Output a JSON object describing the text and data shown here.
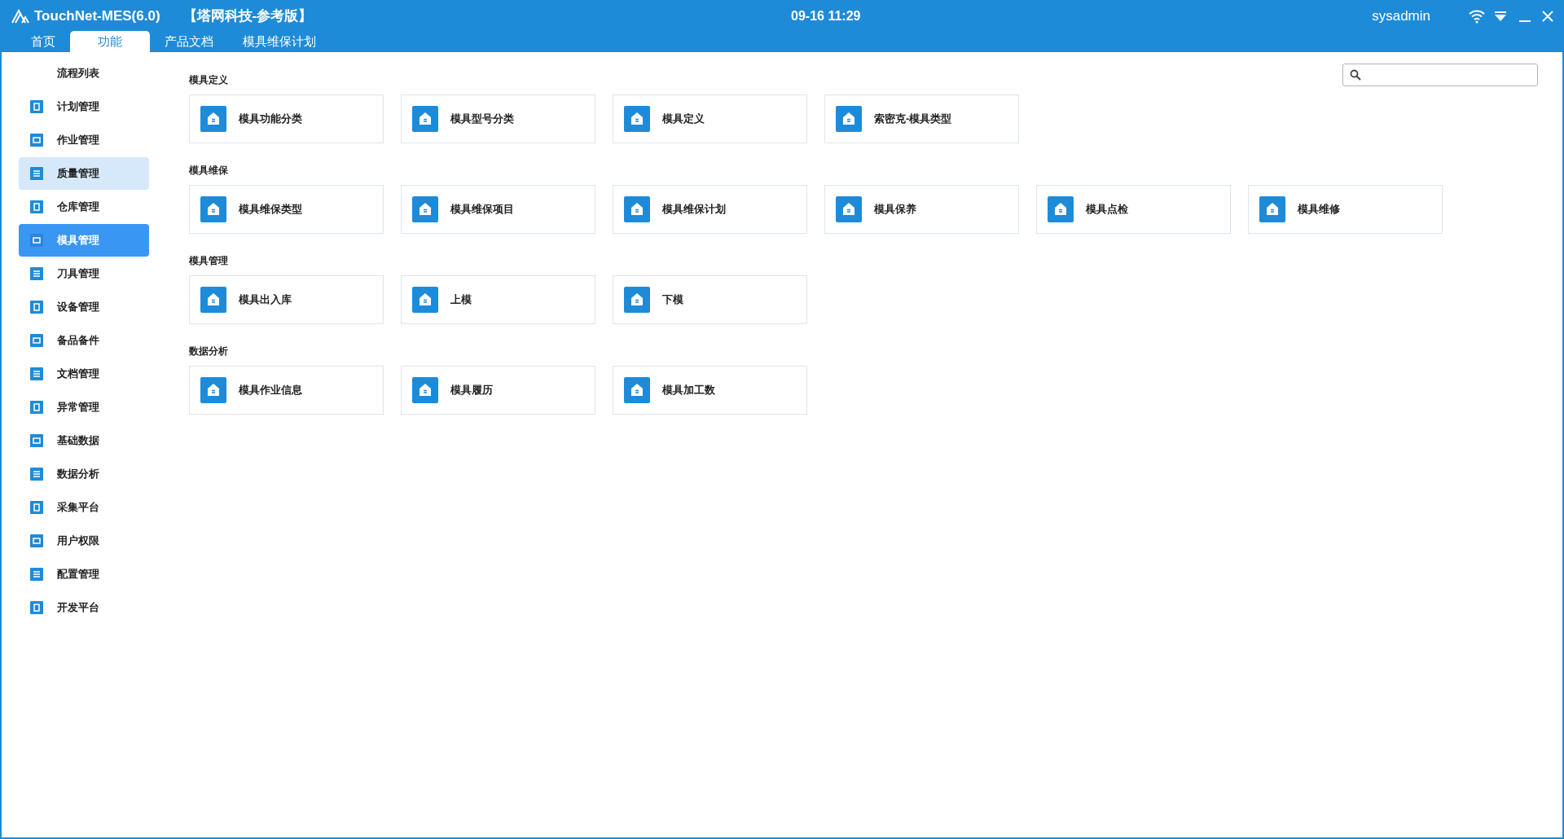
{
  "window": {
    "title": "TouchNet-MES(6.0)",
    "edition": "【塔网科技-参考版】",
    "datetime": "09-16 11:29",
    "user": "sysadmin"
  },
  "tabs": [
    {
      "label": "首页",
      "selected": false
    },
    {
      "label": "功能",
      "selected": true
    },
    {
      "label": "产品文档",
      "selected": false
    },
    {
      "label": "模具维保计划",
      "selected": false
    }
  ],
  "sidebar": {
    "items": [
      {
        "label": "流程列表",
        "kind": "plain",
        "selected": false,
        "hovered": false
      },
      {
        "label": "计划管理",
        "kind": "icon",
        "selected": false,
        "hovered": false
      },
      {
        "label": "作业管理",
        "kind": "icon",
        "selected": false,
        "hovered": false
      },
      {
        "label": "质量管理",
        "kind": "icon",
        "selected": false,
        "hovered": true
      },
      {
        "label": "仓库管理",
        "kind": "icon",
        "selected": false,
        "hovered": false
      },
      {
        "label": "模具管理",
        "kind": "icon",
        "selected": true,
        "hovered": false
      },
      {
        "label": "刀具管理",
        "kind": "icon",
        "selected": false,
        "hovered": false
      },
      {
        "label": "设备管理",
        "kind": "icon",
        "selected": false,
        "hovered": false
      },
      {
        "label": "备品备件",
        "kind": "icon",
        "selected": false,
        "hovered": false
      },
      {
        "label": "文档管理",
        "kind": "icon",
        "selected": false,
        "hovered": false
      },
      {
        "label": "异常管理",
        "kind": "icon",
        "selected": false,
        "hovered": false
      },
      {
        "label": "基础数据",
        "kind": "icon",
        "selected": false,
        "hovered": false
      },
      {
        "label": "数据分析",
        "kind": "icon",
        "selected": false,
        "hovered": false
      },
      {
        "label": "采集平台",
        "kind": "icon",
        "selected": false,
        "hovered": false
      },
      {
        "label": "用户权限",
        "kind": "icon",
        "selected": false,
        "hovered": false
      },
      {
        "label": "配置管理",
        "kind": "icon",
        "selected": false,
        "hovered": false
      },
      {
        "label": "开发平台",
        "kind": "icon",
        "selected": false,
        "hovered": false
      }
    ]
  },
  "sections": [
    {
      "title": "模具定义",
      "cards": [
        "模具功能分类",
        "模具型号分类",
        "模具定义",
        "索密克-模具类型"
      ]
    },
    {
      "title": "模具维保",
      "cards": [
        "模具维保类型",
        "模具维保项目",
        "模具维保计划",
        "模具保养",
        "模具点检",
        "模具维修"
      ]
    },
    {
      "title": "模具管理",
      "cards": [
        "模具出入库",
        "上模",
        "下模"
      ]
    },
    {
      "title": "数据分析",
      "cards": [
        "模具作业信息",
        "模具履历",
        "模具加工数"
      ]
    }
  ]
}
